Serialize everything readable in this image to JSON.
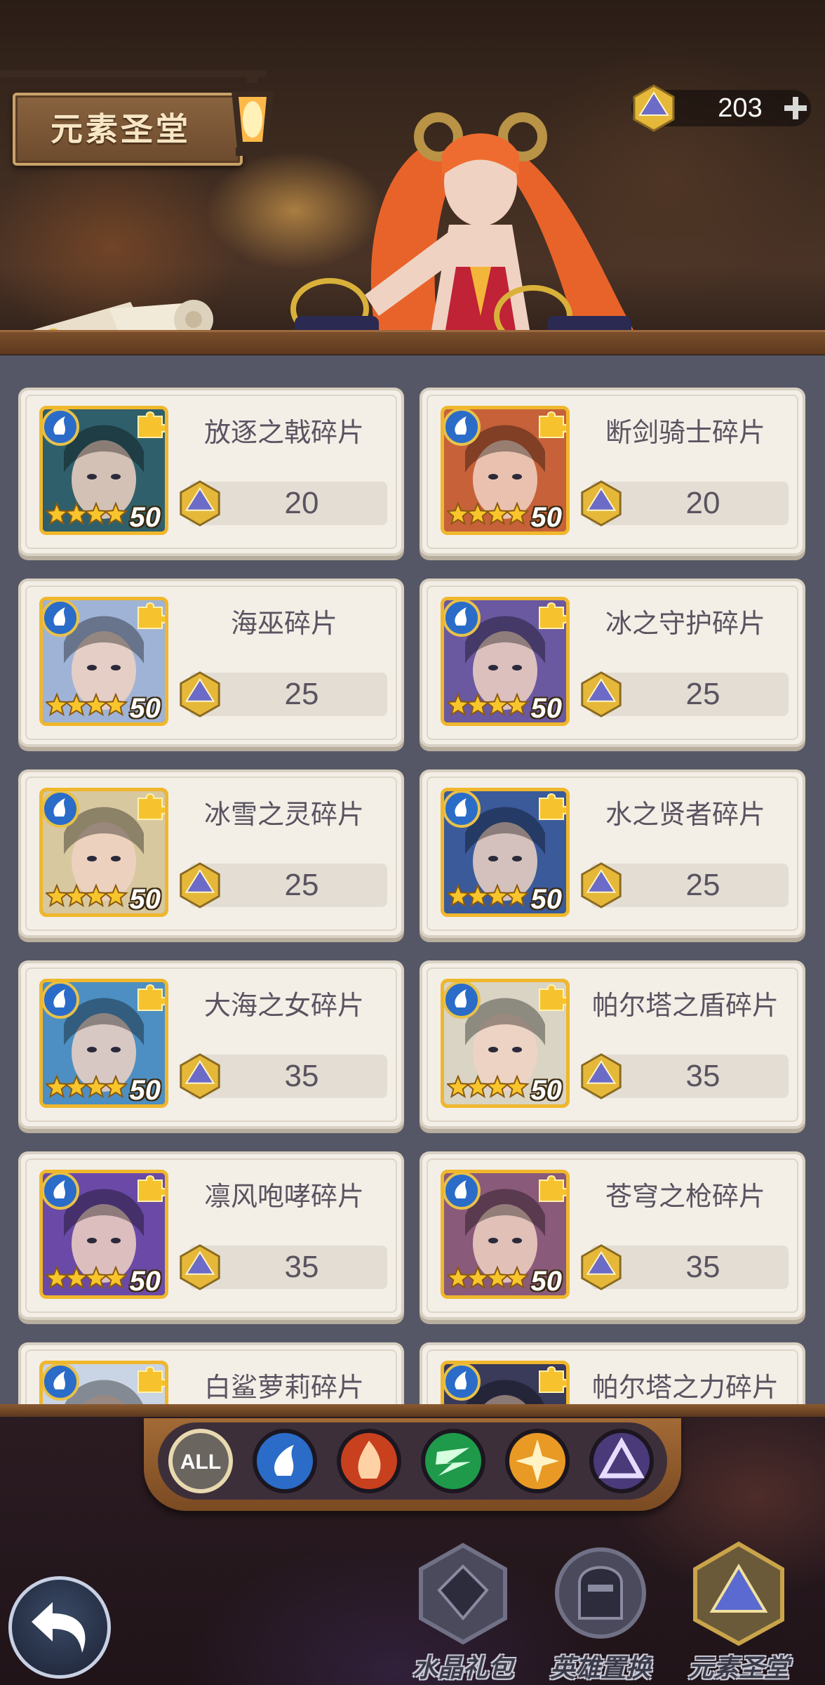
{
  "header": {
    "title": "元素圣堂",
    "currency": {
      "amount": "203",
      "icon": "elemental-gem-icon",
      "add_icon": "plus-icon"
    }
  },
  "shop_items": [
    {
      "name": "放逐之戟碎片",
      "price": "20",
      "level": "50",
      "stars": 4,
      "element": "water",
      "art": "#2f5f6a"
    },
    {
      "name": "断剑骑士碎片",
      "price": "20",
      "level": "50",
      "stars": 4,
      "element": "water",
      "art": "#c6613a"
    },
    {
      "name": "海巫碎片",
      "price": "25",
      "level": "50",
      "stars": 4,
      "element": "water",
      "art": "#9fb3d6"
    },
    {
      "name": "冰之守护碎片",
      "price": "25",
      "level": "50",
      "stars": 4,
      "element": "water",
      "art": "#6a58a0"
    },
    {
      "name": "冰雪之灵碎片",
      "price": "25",
      "level": "50",
      "stars": 4,
      "element": "water",
      "art": "#d8c8a0"
    },
    {
      "name": "水之贤者碎片",
      "price": "25",
      "level": "50",
      "stars": 4,
      "element": "water",
      "art": "#3a5a9a"
    },
    {
      "name": "大海之女碎片",
      "price": "35",
      "level": "50",
      "stars": 4,
      "element": "water",
      "art": "#4d8fc2"
    },
    {
      "name": "帕尔塔之盾碎片",
      "price": "35",
      "level": "50",
      "stars": 4,
      "element": "water",
      "art": "#d9d4c4"
    },
    {
      "name": "凛风咆哮碎片",
      "price": "35",
      "level": "50",
      "stars": 4,
      "element": "water",
      "art": "#6a4aa6"
    },
    {
      "name": "苍穹之枪碎片",
      "price": "35",
      "level": "50",
      "stars": 4,
      "element": "water",
      "art": "#8a5a7a"
    },
    {
      "name": "白鲨萝莉碎片",
      "price": "",
      "level": "",
      "stars": 0,
      "element": "water",
      "art": "#c9d4e4"
    },
    {
      "name": "帕尔塔之力碎片",
      "price": "",
      "level": "",
      "stars": 0,
      "element": "water",
      "art": "#3a3a5a"
    }
  ],
  "filters": [
    {
      "label": "ALL",
      "icon": "all-filter-icon",
      "color": "#6b6560",
      "active": true
    },
    {
      "label": "",
      "icon": "water-element-icon",
      "color": "#2a6cc8",
      "active": false
    },
    {
      "label": "",
      "icon": "fire-element-icon",
      "color": "#c8401e",
      "active": false
    },
    {
      "label": "",
      "icon": "wind-element-icon",
      "color": "#1f9a4a",
      "active": false
    },
    {
      "label": "",
      "icon": "light-element-icon",
      "color": "#e89a24",
      "active": false
    },
    {
      "label": "",
      "icon": "dark-element-icon",
      "color": "#4a3a7a",
      "active": false
    }
  ],
  "bottom_nav": [
    {
      "label": "水晶礼包",
      "icon": "crystal-pack-icon"
    },
    {
      "label": "英雄置换",
      "icon": "hero-swap-icon"
    },
    {
      "label": "元素圣堂",
      "icon": "elemental-temple-icon"
    }
  ],
  "back_icon": "back-arrow-icon"
}
